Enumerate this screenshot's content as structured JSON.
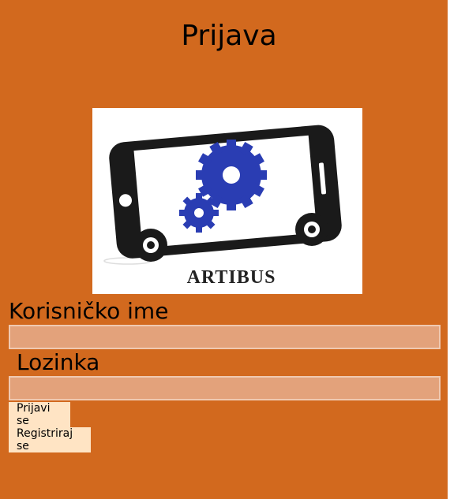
{
  "page": {
    "title": "Prijava"
  },
  "logo": {
    "text": "ARTIBUS",
    "icon": "phone-gears-logo"
  },
  "form": {
    "username_label": "Korisničko ime",
    "username_value": "",
    "password_label": "Lozinka",
    "password_value": "",
    "login_label": "Prijavi se",
    "register_label": "Registriraj se"
  },
  "colors": {
    "background": "#d2691e",
    "field": "#e3a27b",
    "button": "#ffe4c4",
    "gear": "#2a3db3"
  }
}
